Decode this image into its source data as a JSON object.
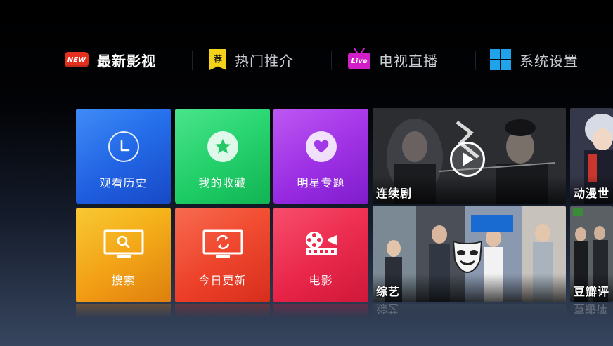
{
  "nav": {
    "items": [
      {
        "label": "最新影视",
        "badge": "NEW",
        "icon": "new-badge-icon",
        "active": true
      },
      {
        "label": "热门推介",
        "badge": "荐",
        "icon": "recommend-badge-icon",
        "active": false
      },
      {
        "label": "电视直播",
        "badge": "Live",
        "icon": "live-tv-icon",
        "active": false
      },
      {
        "label": "系统设置",
        "icon": "windows-icon",
        "active": false
      }
    ]
  },
  "tiles": [
    {
      "label": "观看历史",
      "icon": "clock-icon",
      "color_top": "#2a7ef5",
      "color_bottom": "#1a4fd6"
    },
    {
      "label": "我的收藏",
      "icon": "star-icon",
      "color_top": "#36e07e",
      "color_bottom": "#13c35a"
    },
    {
      "label": "明星专题",
      "icon": "heart-icon",
      "color_top": "#b545f0",
      "color_bottom": "#8a1fdc"
    },
    {
      "label": "搜索",
      "icon": "search-tv-icon",
      "color_top": "#f7c21d",
      "color_bottom": "#f08a10"
    },
    {
      "label": "今日更新",
      "icon": "refresh-tv-icon",
      "color_top": "#f65a3c",
      "color_bottom": "#e8321f"
    },
    {
      "label": "电影",
      "icon": "film-reel-icon",
      "color_top": "#f63a5c",
      "color_bottom": "#e01a3e"
    }
  ],
  "posters": [
    {
      "label": "连续剧",
      "icon": "play-icon"
    },
    {
      "label": "动漫世"
    },
    {
      "label": "综艺",
      "icon": "mask-icon"
    },
    {
      "label": "豆瓣评"
    }
  ],
  "reflections": [
    "综艺",
    "豆瓣评"
  ]
}
